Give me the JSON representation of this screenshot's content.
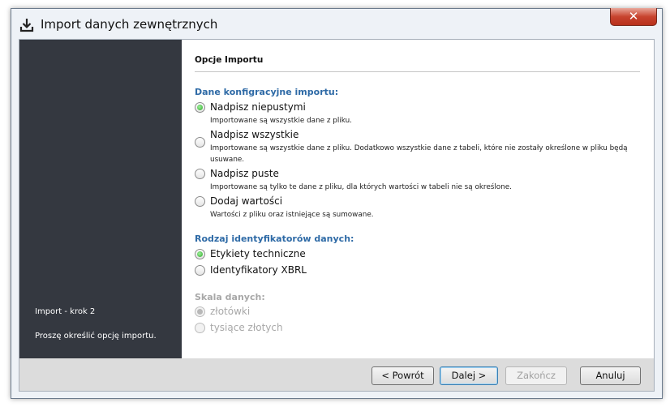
{
  "window": {
    "title": "Import danych zewnętrznych",
    "close_label": "✕"
  },
  "sidebar": {
    "step": "Import - krok 2",
    "message": "Proszę określić opcję importu."
  },
  "content": {
    "section_title": "Opcje Importu",
    "group1": {
      "title": "Dane konfigracyjne importu:",
      "options": [
        {
          "label": "Nadpisz niepustymi",
          "desc": "Importowane są wszystkie dane z pliku.",
          "checked": true
        },
        {
          "label": "Nadpisz wszystkie",
          "desc": "Importowane są wszystkie dane z pliku. Dodatkowo wszystkie dane z tabeli, które nie zostały określone w pliku będą usuwane.",
          "checked": false
        },
        {
          "label": "Nadpisz puste",
          "desc": "Importowane są tylko te dane z pliku, dla których wartości w tabeli nie są określone.",
          "checked": false
        },
        {
          "label": "Dodaj wartości",
          "desc": "Wartości z pliku oraz istniejące są sumowane.",
          "checked": false
        }
      ]
    },
    "group2": {
      "title": "Rodzaj identyfikatorów danych:",
      "options": [
        {
          "label": "Etykiety techniczne",
          "checked": true
        },
        {
          "label": "Identyfikatory XBRL",
          "checked": false
        }
      ]
    },
    "group3": {
      "title": "Skala danych:",
      "disabled": true,
      "options": [
        {
          "label": "złotówki",
          "checked": true
        },
        {
          "label": "tysiące złotych",
          "checked": false
        }
      ]
    }
  },
  "footer": {
    "back": "< Powrót",
    "next": "Dalej >",
    "finish": "Zakończ",
    "cancel": "Anuluj"
  },
  "colors": {
    "sidebar_bg": "#343840",
    "group_title": "#2e6aa6",
    "radio_checked": "#2ea82a"
  }
}
